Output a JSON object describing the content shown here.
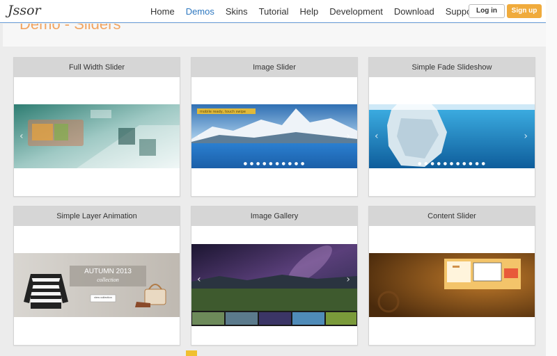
{
  "header": {
    "logo": "Jssor",
    "nav": [
      "Home",
      "Demos",
      "Skins",
      "Tutorial",
      "Help",
      "Development",
      "Download",
      "Support"
    ],
    "active_nav": "Demos",
    "login_label": "Log in",
    "signup_label": "Sign up"
  },
  "page": {
    "title": "Demo - Sliders"
  },
  "cards": [
    {
      "title": "Full Width Slider"
    },
    {
      "title": "Image Slider"
    },
    {
      "title": "Simple Fade Slideshow"
    },
    {
      "title": "Simple Layer Animation"
    },
    {
      "title": "Image Gallery"
    },
    {
      "title": "Content Slider"
    }
  ],
  "layer_slide": {
    "headline": "AUTUMN 2013",
    "subline": "collection",
    "button_label": "view collection"
  },
  "image_slide": {
    "caption": "mobile ready, touch swipe"
  },
  "colors": {
    "accent": "#2e78c0",
    "brand_orange": "#f0ab3c",
    "card_header": "#d6d6d6"
  },
  "icons": {
    "prev": "chevron-left-icon",
    "next": "chevron-right-icon"
  }
}
